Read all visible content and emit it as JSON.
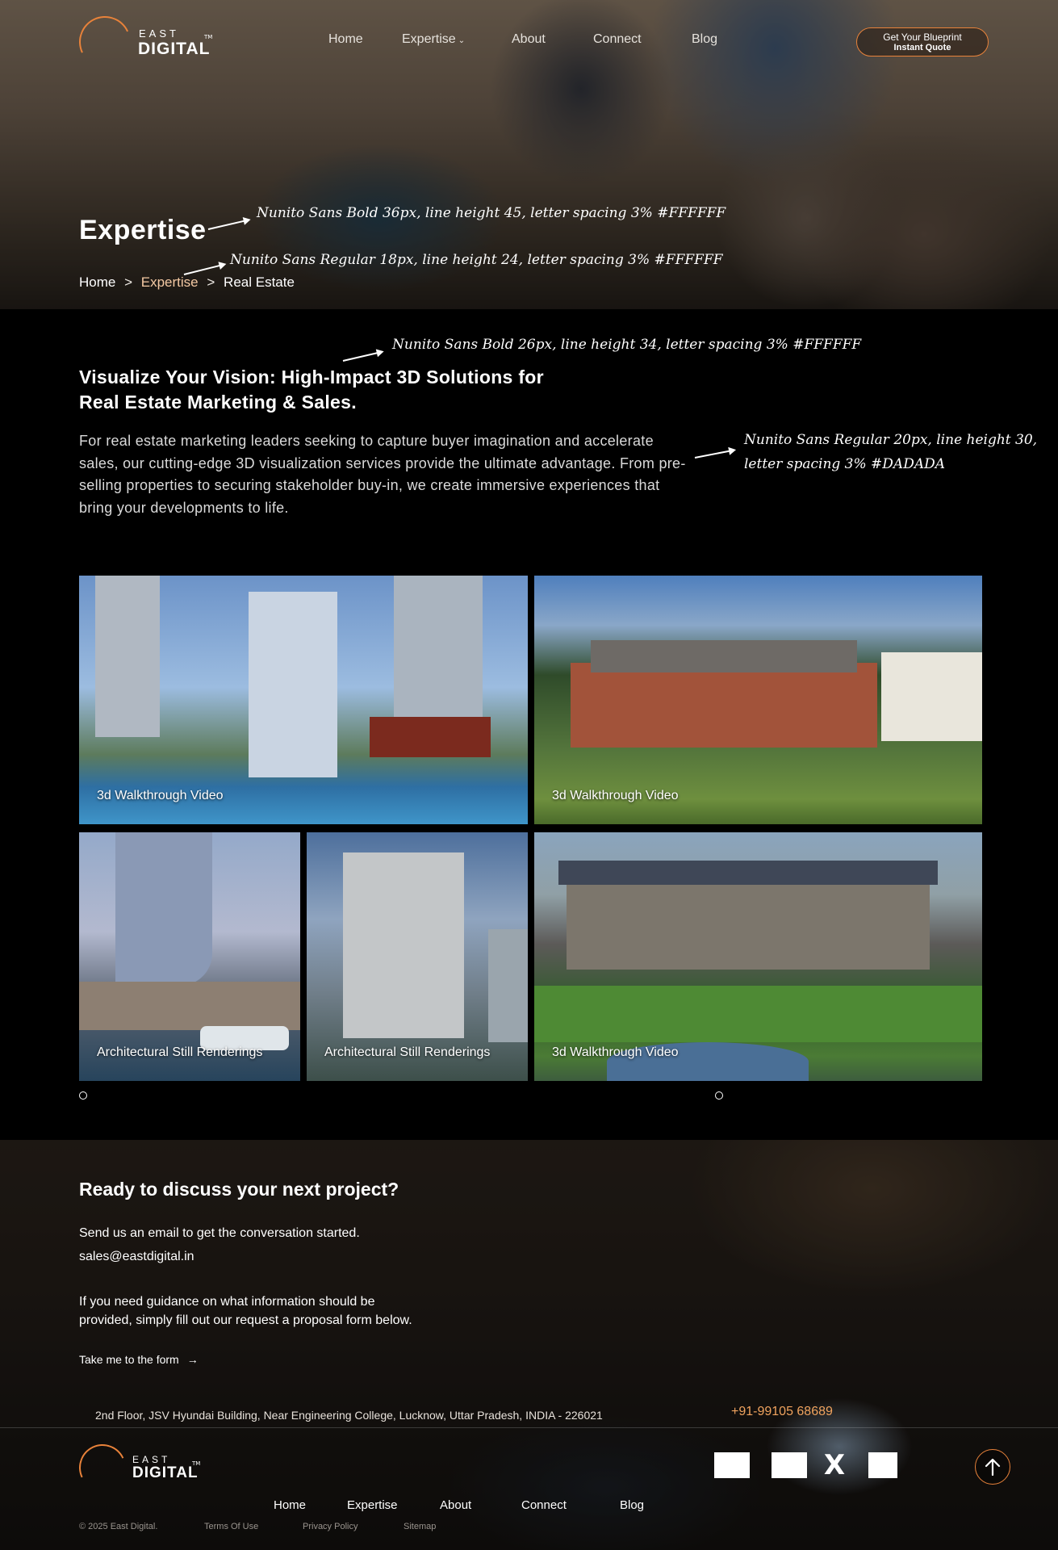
{
  "brand": {
    "east": "EAST",
    "digital": "DIGITAL",
    "tm": "TM",
    "accent": "#e8823a"
  },
  "nav": {
    "items": [
      "Home",
      "Expertise",
      "About",
      "Connect",
      "Blog"
    ],
    "chevron": "⌄",
    "cta_line1": "Get Your Blueprint",
    "cta_line2": "Instant Quote"
  },
  "hero": {
    "title": "Expertise",
    "breadcrumb": {
      "home": "Home",
      "section": "Expertise",
      "current": "Real Estate",
      "separator": ">"
    }
  },
  "annotations": [
    "Nunito Sans Bold 36px, line height 45, letter spacing 3% #FFFFFF",
    "Nunito Sans Regular 18px, line height 24, letter spacing 3% #FFFFFF",
    "Nunito Sans Bold 26px, line height 34, letter spacing 3% #FFFFFF",
    "Nunito Sans Regular 20px, line height 30,",
    "letter spacing 3% #DADADA"
  ],
  "intro": {
    "title_line1": "Visualize Your Vision: High-Impact 3D Solutions for",
    "title_line2": "Real Estate Marketing & Sales.",
    "body": "For real estate marketing leaders seeking to capture buyer imagination and accelerate sales, our cutting-edge 3D visualization services provide the ultimate advantage. From pre-selling properties to securing stakeholder buy-in, we create immersive experiences that bring your developments to life.",
    "body_color": "#DADADA"
  },
  "gallery": [
    {
      "caption": "3d Walkthrough Video",
      "icon": "high-rise-pool-render"
    },
    {
      "caption": "3d Walkthrough Video",
      "icon": "brick-house-render"
    },
    {
      "caption": "Architectural Still Renderings",
      "icon": "curved-tower-render"
    },
    {
      "caption": "Architectural Still Renderings",
      "icon": "apartment-block-render"
    },
    {
      "caption": "3d Walkthrough Video",
      "icon": "villa-garden-render"
    }
  ],
  "contact": {
    "heading": "Ready to discuss your next project?",
    "email_prompt": "Send us an email to get the conversation started.",
    "email": "sales@eastdigital.in",
    "guidance": "If you need guidance on what information should be provided, simply fill out our request a proposal form below.",
    "form_link": "Take me to the form",
    "form_arrow": "→",
    "address": "2nd Floor, JSV Hyundai Building, Near Engineering College, Lucknow, Uttar Pradesh, INDIA - 226021",
    "phone": "+91-99105 68689",
    "phone_color": "#f0a35e"
  },
  "footer": {
    "nav": [
      "Home",
      "Expertise",
      "About",
      "Connect",
      "Blog"
    ],
    "social_icons": [
      "facebook-icon",
      "instagram-icon",
      "x-icon",
      "linkedin-icon"
    ],
    "x_glyph": "X",
    "copyright": "© 2025 East Digital.",
    "terms": "Terms Of Use",
    "privacy": "Privacy Policy",
    "sitemap": "Sitemap"
  }
}
